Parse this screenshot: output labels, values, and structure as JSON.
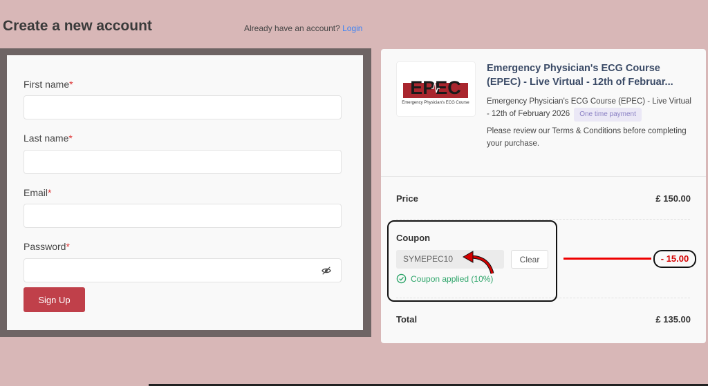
{
  "header": {
    "title": "Create a new account",
    "have_account": "Already have an account?",
    "login_link": "Login"
  },
  "form": {
    "fields": [
      {
        "label": "First name",
        "value": ""
      },
      {
        "label": "Last name",
        "value": ""
      },
      {
        "label": "Email",
        "value": ""
      },
      {
        "label": "Password",
        "value": ""
      }
    ],
    "required_mark": "*",
    "signup_label": "Sign Up"
  },
  "product": {
    "logo_text": "EPEC",
    "logo_subtitle": "Emergency Physician's ECG Course",
    "title_line1": "Emergency Physician's ECG Course",
    "title_line2": "(EPEC) - Live Virtual - 12th of Februar...",
    "description": "Emergency Physician's ECG Course (EPEC) - Live Virtual - 12th of February 2026",
    "badge": "One time payment",
    "terms": "Please review our Terms & Conditions before completing your purchase."
  },
  "summary": {
    "price_label": "Price",
    "price_value": "£ 150.00",
    "coupon_label": "Coupon",
    "coupon_code": "SYMEPEC10",
    "clear_label": "Clear",
    "applied_text": "Coupon applied (10%)",
    "discount_value": "- 15.00",
    "total_label": "Total",
    "total_value": "£ 135.00"
  },
  "colors": {
    "background": "#d8b7b7",
    "primary_button": "#c0404a",
    "link": "#3b82f6",
    "success": "#2ea56a",
    "annotation_red": "#e00000"
  }
}
